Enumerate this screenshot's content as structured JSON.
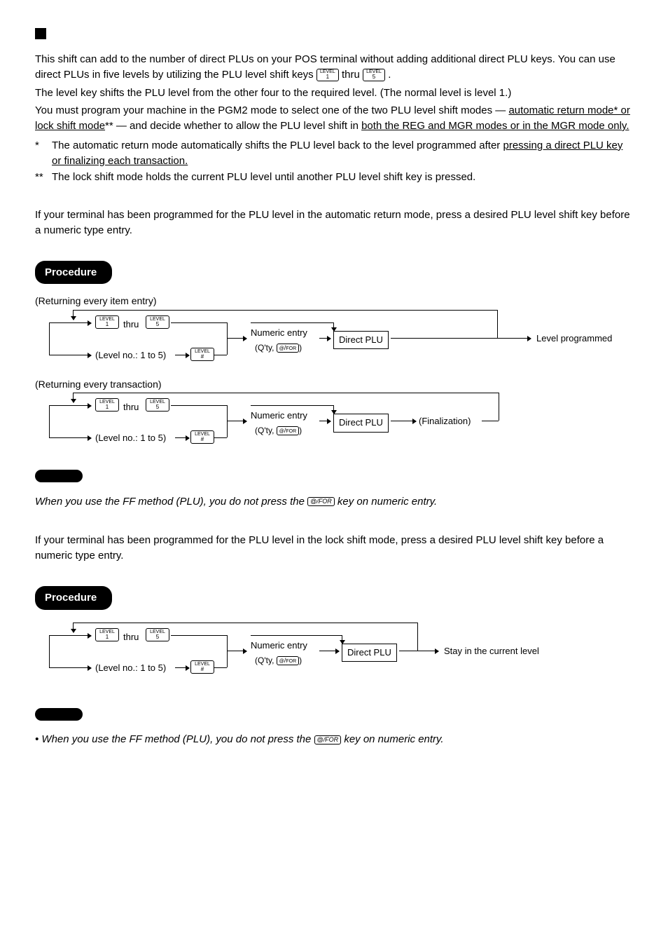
{
  "intro": {
    "p1a": "This shift can add to the number of direct PLUs on your POS terminal without adding additional direct PLU keys. You can use direct PLUs in five levels by utilizing the PLU level shift keys ",
    "p1b": " thru ",
    "p1c": ".",
    "p2": "The level key shifts the PLU level from the other four to the required level. (The normal level is level 1.)",
    "p3a": "You must program your machine in the PGM2 mode to select one of the two PLU level shift modes — ",
    "p3u1": "automatic return mode* or lock shift mode",
    "p3b": "** — and decide whether to allow the PLU level shift in ",
    "p3u2": "both the REG and MGR modes or in the MGR mode only.",
    "fn1a": "The automatic return mode automatically shifts the PLU level back to the level programmed after ",
    "fn1u": "pressing a direct PLU key or finalizing each transaction.",
    "fn2": "The lock shift mode holds the current PLU level until another PLU level shift key is pressed."
  },
  "keys": {
    "level_label": "LEVEL",
    "l1": "1",
    "l5": "5",
    "hash": "#",
    "at_for_top": "@",
    "at_for_bot": "FOR",
    "at_for_inline": "@/FOR"
  },
  "auto_mode": {
    "intro": "If your terminal has been programmed for the PLU level in the automatic return mode, press a desired PLU level shift key before a numeric type entry.",
    "procedure": "Procedure",
    "caption_item": "(Returning every item entry)",
    "caption_trans": "(Returning every transaction)",
    "thru": "thru",
    "level_no": "(Level no.: 1 to 5)",
    "numeric": "Numeric entry",
    "qty_a": "(Q'ty, ",
    "qty_b": ")",
    "direct_plu": "Direct PLU",
    "level_prog": "Level programmed",
    "finalization": "(Finalization)",
    "note_a": "When you use the FF method (PLU), you do not press the ",
    "note_b": " key on numeric entry."
  },
  "lock_mode": {
    "intro": "If your terminal has been programmed for the PLU level in the lock shift mode, press a desired PLU level shift key before a numeric type entry.",
    "procedure": "Procedure",
    "stay": "Stay in the current level",
    "note_a": "• When you use the FF method (PLU),  you do not press the ",
    "note_b": " key on numeric entry."
  }
}
